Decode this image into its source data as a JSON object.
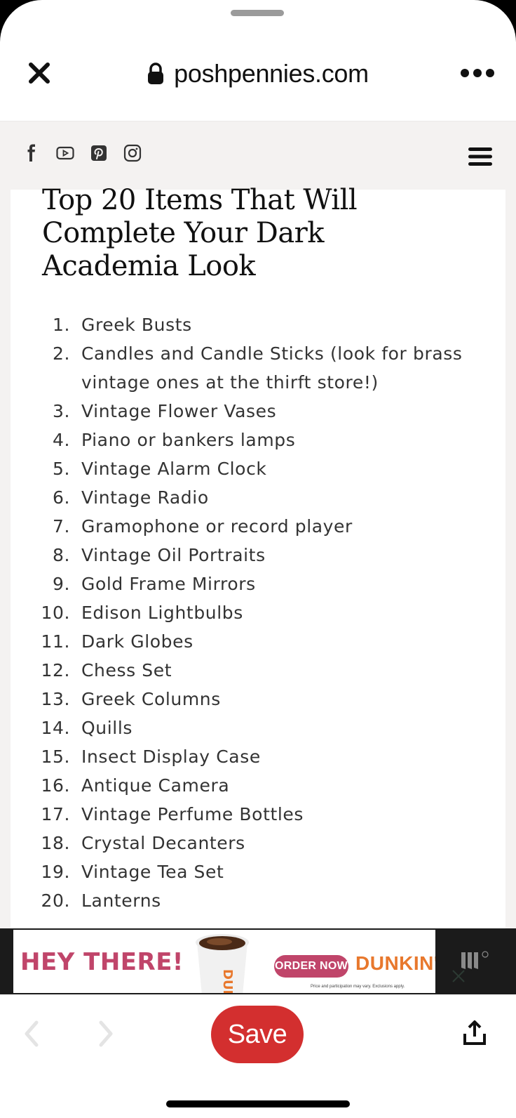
{
  "browser": {
    "url": "poshpennies.com",
    "close_icon": "close-icon",
    "lock_icon": "lock-icon",
    "more_icon": "more-options-icon"
  },
  "site_header": {
    "social_icons": [
      "facebook-icon",
      "youtube-icon",
      "pinterest-icon",
      "instagram-icon"
    ],
    "menu_icon": "hamburger-menu-icon",
    "background": "#f4f2f1"
  },
  "article": {
    "title": "Top 20 Items That Will Complete Your Dark Academia Look",
    "items": [
      {
        "num": "1.",
        "text": "Greek Busts"
      },
      {
        "num": "2.",
        "text": "Candles and Candle Sticks (look for brass vintage ones at the thirft store!)"
      },
      {
        "num": "3.",
        "text": "Vintage Flower Vases"
      },
      {
        "num": "4.",
        "text": "Piano or bankers lamps"
      },
      {
        "num": "5.",
        "text": "Vintage Alarm Clock"
      },
      {
        "num": "6.",
        "text": "Vintage Radio"
      },
      {
        "num": "7.",
        "text": "Gramophone or record player"
      },
      {
        "num": "8.",
        "text": "Vintage Oil Portraits"
      },
      {
        "num": "9.",
        "text": "Gold Frame Mirrors"
      },
      {
        "num": "10.",
        "text": "Edison Lightbulbs"
      },
      {
        "num": "11.",
        "text": "Dark Globes"
      },
      {
        "num": "12.",
        "text": "Chess Set"
      },
      {
        "num": "13.",
        "text": "Greek Columns"
      },
      {
        "num": "14.",
        "text": "Quills"
      },
      {
        "num": "15.",
        "text": "Insect Display Case"
      },
      {
        "num": "16.",
        "text": "Antique Camera"
      },
      {
        "num": "17.",
        "text": "Vintage Perfume Bottles"
      },
      {
        "num": "18.",
        "text": "Crystal Decanters"
      },
      {
        "num": "19.",
        "text": "Vintage Tea Set"
      },
      {
        "num": "20.",
        "text": "Lanterns"
      }
    ]
  },
  "ad": {
    "headline": "HEY THERE!",
    "cta": "ORDER NOW",
    "brand": "DUNKIN'",
    "cup_text": "DUN",
    "fine_print": "Price and participation may vary. Exclusions apply.",
    "colors": {
      "pink": "#c0456a",
      "orange": "#e8782d"
    }
  },
  "bottom_bar": {
    "save_label": "Save",
    "save_color": "#d32f2f",
    "prev_icon": "chevron-left-icon",
    "next_icon": "chevron-right-icon",
    "share_icon": "share-icon"
  }
}
